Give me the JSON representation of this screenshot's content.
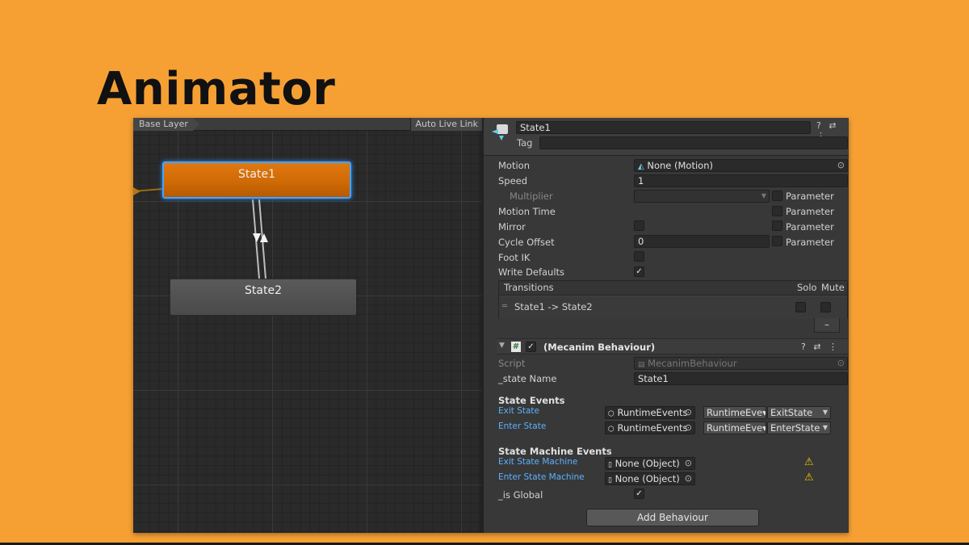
{
  "slide": {
    "title": "Animator"
  },
  "graph": {
    "breadcrumb": "Base Layer",
    "live_link": "Auto Live Link",
    "states": [
      {
        "name": "State1",
        "color": "#cf6a06"
      },
      {
        "name": "State2",
        "color": "#4e4e4e"
      }
    ]
  },
  "inspector": {
    "state_name": "State1",
    "tag_label": "Tag",
    "tag_value": "",
    "header_icons": "? ⇄ ⋮",
    "motion": {
      "label": "Motion",
      "value": "None (Motion)"
    },
    "speed": {
      "label": "Speed",
      "value": "1"
    },
    "multiplier": {
      "label": "Multiplier",
      "value": ""
    },
    "motion_time": {
      "label": "Motion Time"
    },
    "mirror": {
      "label": "Mirror"
    },
    "cycle_offset": {
      "label": "Cycle Offset",
      "value": "0"
    },
    "foot_ik": {
      "label": "Foot IK"
    },
    "write_defaults": {
      "label": "Write Defaults",
      "checked": "✓"
    },
    "parameter_label": "Parameter",
    "transitions": {
      "header": "Transitions",
      "solo": "Solo",
      "mute": "Mute",
      "items": [
        {
          "label": "State1 -> State2"
        }
      ],
      "remove": "–"
    },
    "behaviour": {
      "title": "(Mecanim Behaviour)",
      "enabled": "✓",
      "icons": "? ⇄ ⋮",
      "script_label": "Script",
      "script_value": "MecanimBehaviour",
      "state_name_label": "_state Name",
      "state_name_value": "State1",
      "state_events_label": "State Events",
      "exit_state_label": "Exit State",
      "exit_state_obj": "RuntimeEvents",
      "exit_state_comp": "RuntimeEve▾",
      "exit_state_method": "ExitState",
      "enter_state_label": "Enter State",
      "enter_state_obj": "RuntimeEvents",
      "enter_state_comp": "RuntimeEve▾",
      "enter_state_method": "EnterState",
      "sm_events_label": "State Machine Events",
      "exit_sm_label": "Exit State Machine",
      "exit_sm_value": "None (Object)",
      "enter_sm_label": "Enter State Machine",
      "enter_sm_value": "None (Object)",
      "is_global_label": "_is Global",
      "is_global_checked": "✓"
    },
    "add_behaviour": "Add Behaviour"
  }
}
